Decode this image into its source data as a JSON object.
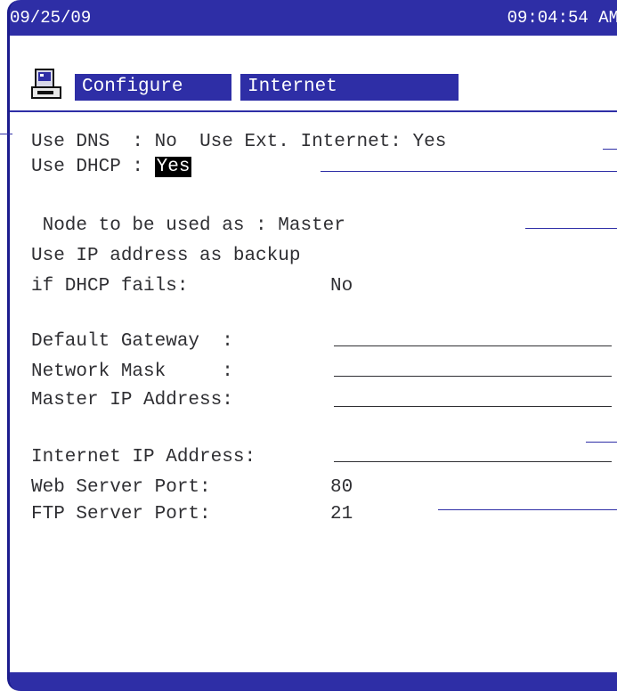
{
  "header": {
    "date": "09/25/09",
    "time": "09:04:54 AM"
  },
  "menu": {
    "configure": "Configure",
    "internet": "Internet"
  },
  "fields": {
    "use_dns_label": "Use DNS  : ",
    "use_dns_value": "No",
    "use_ext_label": "Use Ext. Internet: ",
    "use_ext_value": "Yes",
    "use_dhcp_label": "Use DHCP : ",
    "use_dhcp_value": "Yes",
    "node_label": " Node to be used as : ",
    "node_value": "Master",
    "backup_label": "Use IP address as backup",
    "dhcp_fails_label": "if DHCP fails:",
    "dhcp_fails_value": "No",
    "default_gateway_label": "Default Gateway  :",
    "network_mask_label": "Network Mask     :",
    "master_ip_label": "Master IP Address:",
    "internet_ip_label": "Internet IP Address:",
    "web_port_label": "Web Server Port:",
    "web_port_value": "80",
    "ftp_port_label": "FTP Server Port:",
    "ftp_port_value": "21"
  },
  "icons": {
    "terminal": "terminal-icon"
  },
  "colors": {
    "bar": "#2e2ea6",
    "text": "#2f2f33"
  }
}
